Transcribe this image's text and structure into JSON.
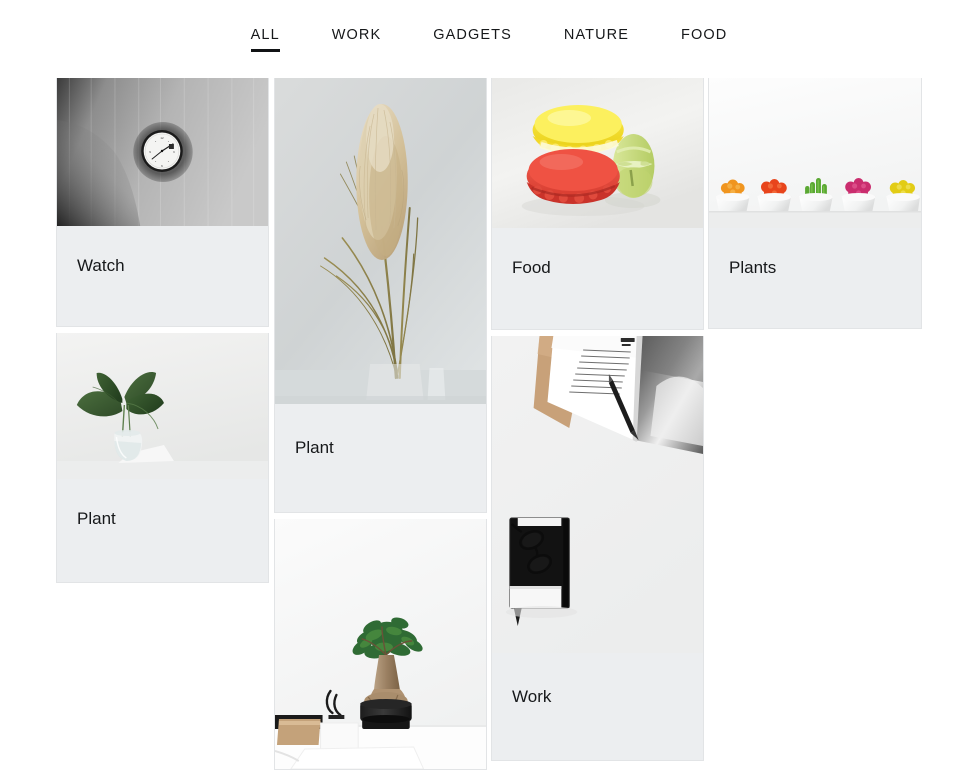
{
  "nav": {
    "items": [
      {
        "label": "ALL",
        "active": true
      },
      {
        "label": "WORK",
        "active": false
      },
      {
        "label": "GADGETS",
        "active": false
      },
      {
        "label": "NATURE",
        "active": false
      },
      {
        "label": "FOOD",
        "active": false
      }
    ]
  },
  "theme": {
    "page_background": "#ffffff",
    "card_background": "#eceef0",
    "card_border": "#e2e4e6",
    "text_color": "#16181a",
    "active_underline": "#111315"
  },
  "gallery": {
    "columns": [
      {
        "id": "column-1",
        "cards": [
          {
            "title": "Watch",
            "photo": "grayscale-wall-clock",
            "photo_height": 148,
            "caption_height": 100
          },
          {
            "title": "Plant",
            "photo": "leaf-in-glass-vase",
            "photo_height": 146,
            "caption_height": 103
          }
        ]
      },
      {
        "id": "column-2",
        "cards": [
          {
            "title": "Plant",
            "photo": "pampas-grass-in-vase",
            "photo_height": 326,
            "caption_height": 108
          },
          {
            "title": "",
            "photo": "bonsai-on-desk",
            "photo_height": 250,
            "caption_height": 0
          }
        ]
      },
      {
        "id": "column-3",
        "cards": [
          {
            "title": "Food",
            "photo": "macarons-yellow-red-green",
            "photo_height": 150,
            "caption_height": 101
          },
          {
            "title": "Work",
            "photo": "open-magazine-pen-notebook-glasses",
            "photo_height": 317,
            "caption_height": 107
          }
        ]
      },
      {
        "id": "column-4",
        "cards": [
          {
            "title": "Plants",
            "photo": "five-cactus-pots-on-shelf",
            "photo_height": 150,
            "caption_height": 100
          }
        ]
      }
    ]
  }
}
